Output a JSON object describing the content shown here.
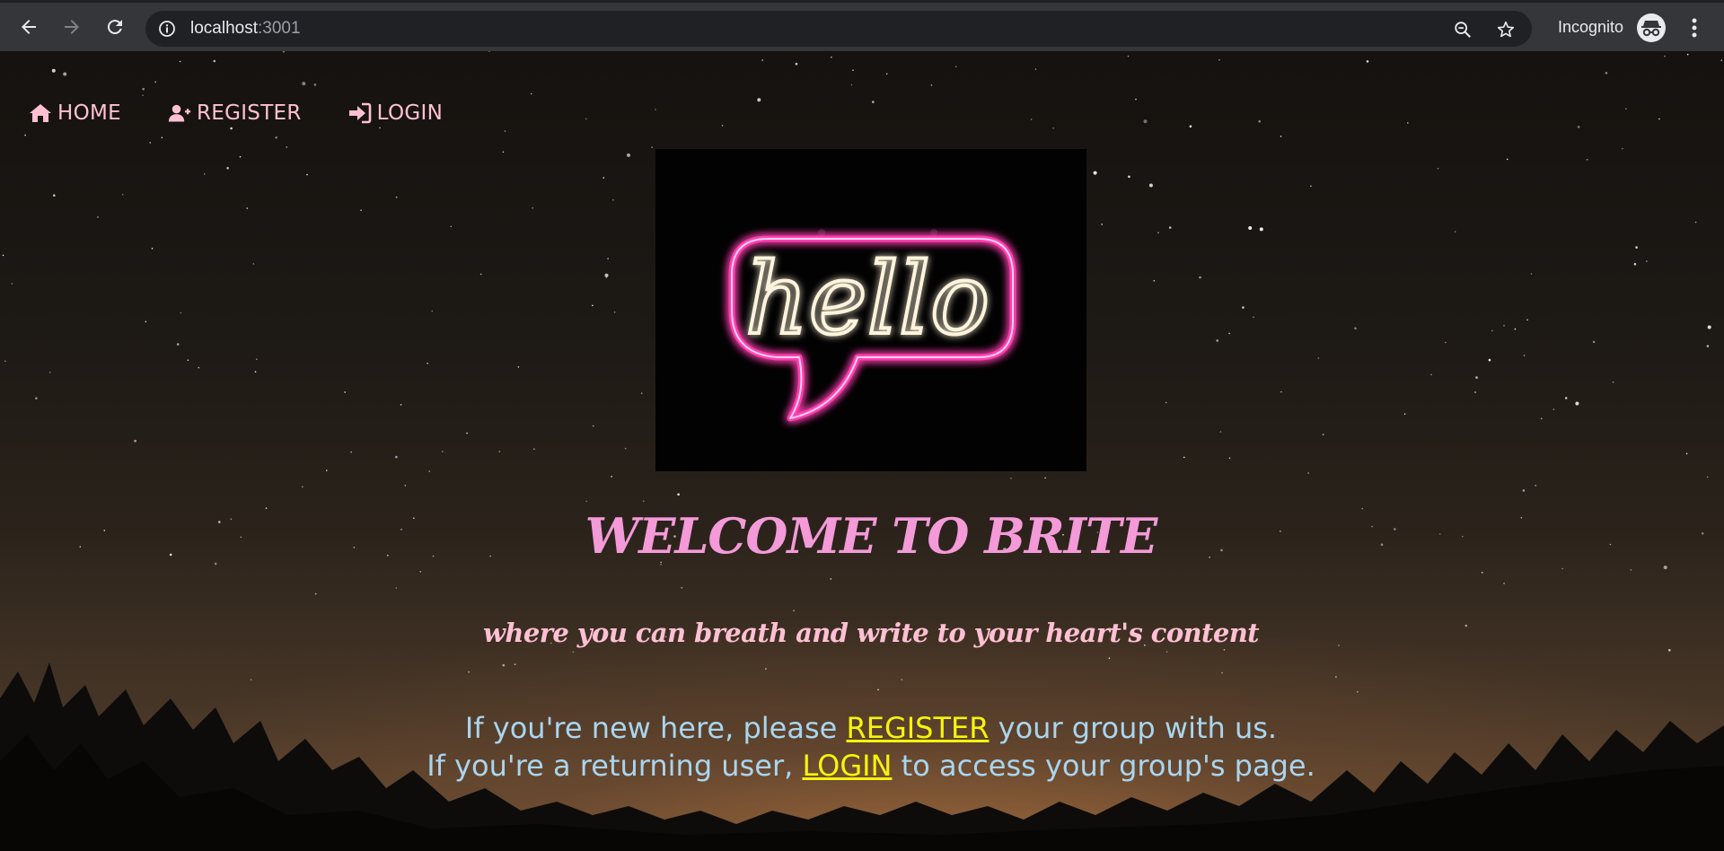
{
  "browser": {
    "url_host": "localhost",
    "url_port": ":3001",
    "incognito_label": "Incognito"
  },
  "nav": {
    "home": "HOME",
    "register": "REGISTER",
    "login": "LOGIN"
  },
  "hero": {
    "sign_text": "hello"
  },
  "welcome_title": "WELCOME TO BRITE",
  "tagline": "where you can breath and write to your heart's content",
  "cta": {
    "line1_before": "If you're new here, please ",
    "line1_link": "REGISTER",
    "line1_after": " your group with us.",
    "line2_before": "If you're a returning user, ",
    "line2_link": "LOGIN",
    "line2_after": " to access your group's page."
  },
  "colors": {
    "nav_text": "#ffc0d4",
    "title": "#f49ad8",
    "cta_text": "#a9d5ef",
    "cta_link": "#f5f50a"
  }
}
